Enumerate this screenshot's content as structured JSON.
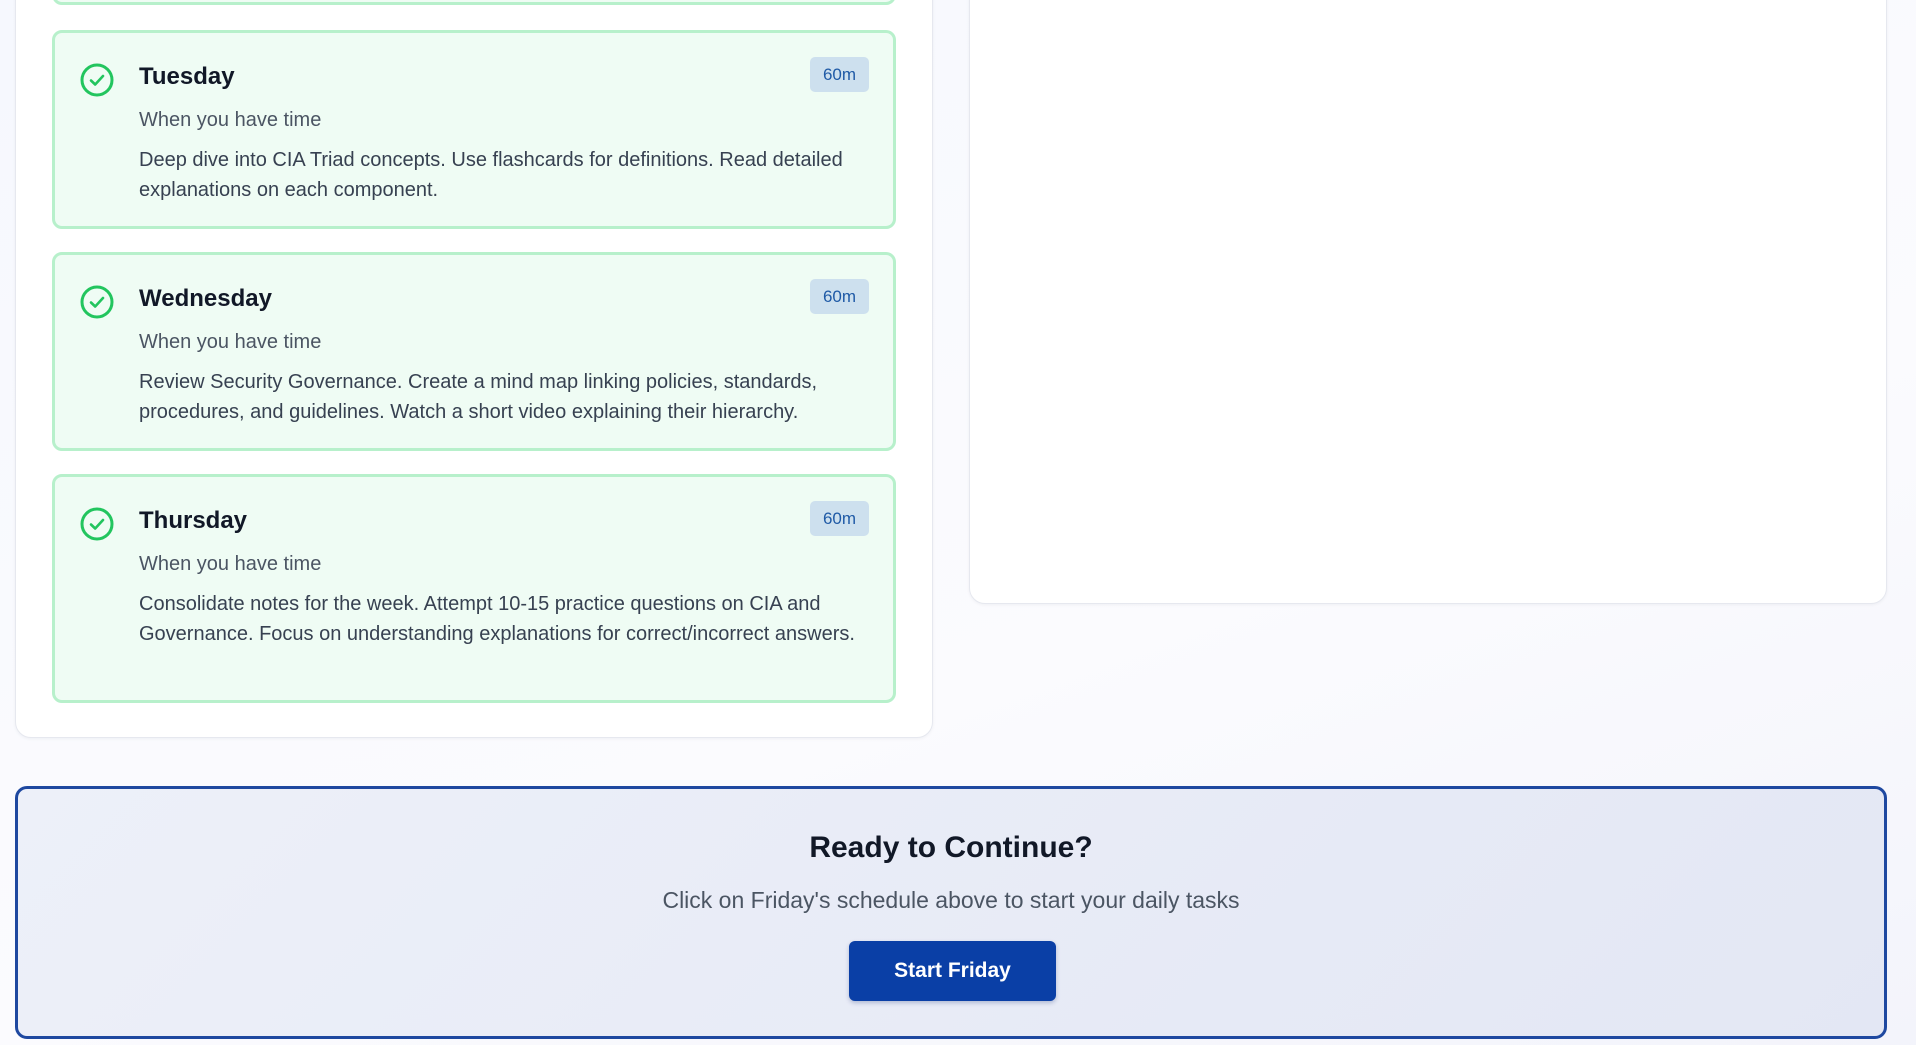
{
  "schedule": {
    "days": [
      {
        "day": "Tuesday",
        "duration": "60m",
        "subtitle": "When you have time",
        "description": "Deep dive into CIA Triad concepts. Use flashcards for definitions. Read detailed explanations on each component.",
        "status_icon": "check-circle-icon"
      },
      {
        "day": "Wednesday",
        "duration": "60m",
        "subtitle": "When you have time",
        "description": "Review Security Governance. Create a mind map linking policies, standards, procedures, and guidelines. Watch a short video explaining their hierarchy.",
        "status_icon": "check-circle-icon"
      },
      {
        "day": "Thursday",
        "duration": "60m",
        "subtitle": "When you have time",
        "description": "Consolidate notes for the week. Attempt 10-15 practice questions on CIA and Governance. Focus on understanding explanations for correct/incorrect answers.",
        "status_icon": "check-circle-icon"
      }
    ]
  },
  "cta": {
    "title": "Ready to Continue?",
    "text": "Click on Friday's schedule above to start your daily tasks",
    "button_label": "Start Friday"
  },
  "colors": {
    "completed_green": "#22c55e",
    "card_background": "#effcf4",
    "card_border": "#b7f0cb",
    "badge_background": "#cde0ee",
    "badge_text": "#1f5aa6",
    "primary_blue": "#0a3fa6",
    "cta_border": "#1e48a0"
  }
}
